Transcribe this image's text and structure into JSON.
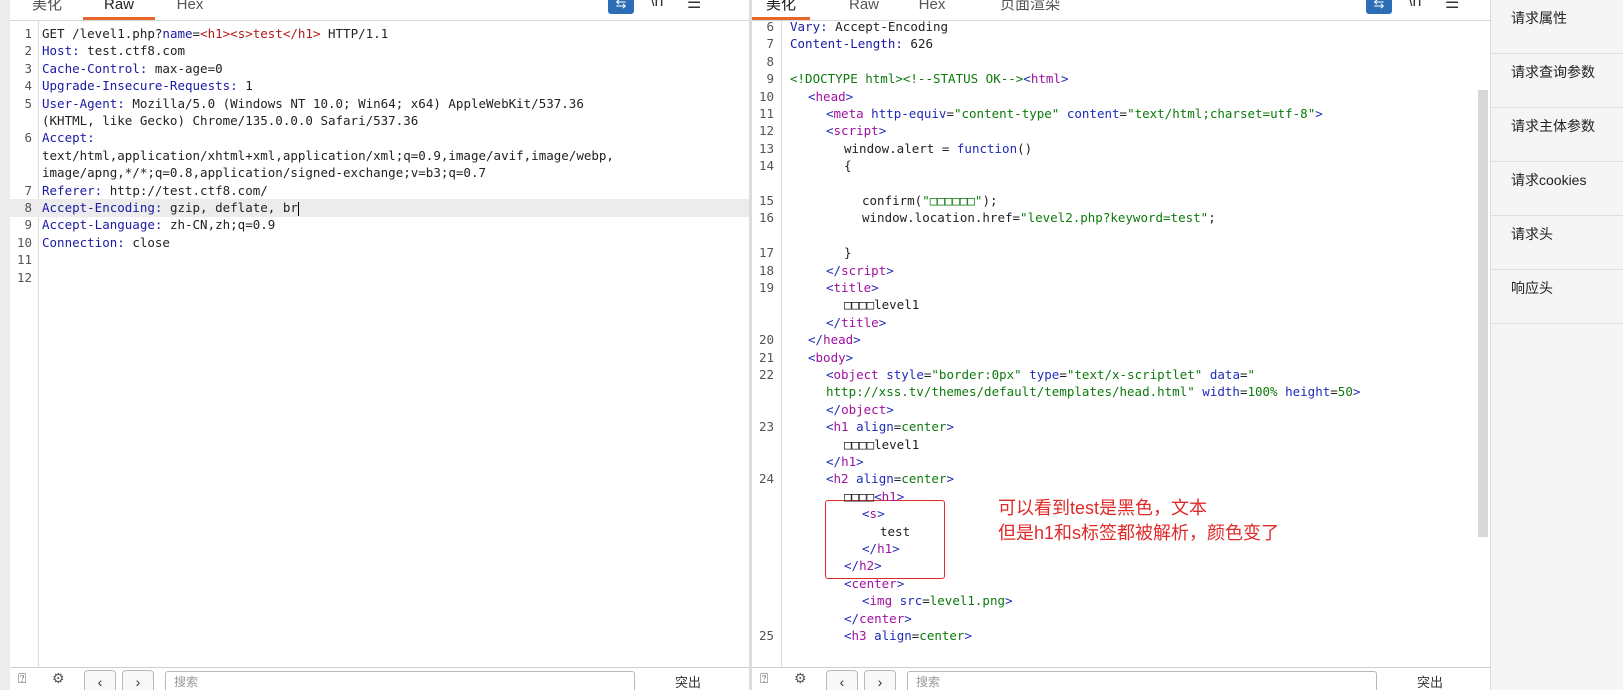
{
  "request_pane": {
    "tabs": [
      {
        "label": "美化",
        "active": false
      },
      {
        "label": "Raw",
        "active": true
      },
      {
        "label": "Hex",
        "active": false
      }
    ],
    "toolbar_icons": [
      "wrap-icon",
      "newline-icon",
      "menu-icon"
    ],
    "lines": [
      {
        "num": "1",
        "parts": [
          [
            "plain",
            "GET /level1.php?"
          ],
          [
            "key",
            "name"
          ],
          [
            "plain",
            "="
          ],
          [
            "red",
            "<h1><s>test</h1>"
          ],
          [
            "plain",
            " HTTP/1.1"
          ]
        ]
      },
      {
        "num": "2",
        "parts": [
          [
            "key",
            "Host:"
          ],
          [
            "plain",
            " test.ctf8.com"
          ]
        ]
      },
      {
        "num": "3",
        "parts": [
          [
            "key",
            "Cache-Control:"
          ],
          [
            "plain",
            " max-age=0"
          ]
        ]
      },
      {
        "num": "4",
        "parts": [
          [
            "key",
            "Upgrade-Insecure-Requests:"
          ],
          [
            "plain",
            " 1"
          ]
        ]
      },
      {
        "num": "5",
        "parts": [
          [
            "key",
            "User-Agent:"
          ],
          [
            "plain",
            " Mozilla/5.0 (Windows NT 10.0; Win64; x64) AppleWebKit/537.36"
          ]
        ]
      },
      {
        "num": "",
        "parts": [
          [
            "plain",
            "(KHTML, like Gecko) Chrome/135.0.0.0 Safari/537.36"
          ]
        ]
      },
      {
        "num": "6",
        "parts": [
          [
            "key",
            "Accept:"
          ]
        ]
      },
      {
        "num": "",
        "parts": [
          [
            "plain",
            "text/html,application/xhtml+xml,application/xml;q=0.9,image/avif,image/webp,"
          ]
        ]
      },
      {
        "num": "",
        "parts": [
          [
            "plain",
            "image/apng,*/*;q=0.8,application/signed-exchange;v=b3;q=0.7"
          ]
        ]
      },
      {
        "num": "7",
        "parts": [
          [
            "key",
            "Referer:"
          ],
          [
            "plain",
            " http://test.ctf8.com/"
          ]
        ]
      },
      {
        "num": "8",
        "parts": [
          [
            "key",
            "Accept-Encoding:"
          ],
          [
            "plain",
            " gzip, deflate, br"
          ]
        ],
        "highlight": true,
        "cursor": true
      },
      {
        "num": "9",
        "parts": [
          [
            "key",
            "Accept-Language:"
          ],
          [
            "plain",
            " zh-CN,zh;q=0.9"
          ]
        ]
      },
      {
        "num": "10",
        "parts": [
          [
            "key",
            "Connection:"
          ],
          [
            "plain",
            " close"
          ]
        ]
      },
      {
        "num": "11",
        "parts": []
      },
      {
        "num": "12",
        "parts": []
      }
    ],
    "search_placeholder": "搜索"
  },
  "response_pane": {
    "tabs": [
      {
        "label": "美化",
        "active": true
      },
      {
        "label": "Raw",
        "active": false
      },
      {
        "label": "Hex",
        "active": false
      },
      {
        "label": "页面渲染",
        "active": false
      }
    ],
    "toolbar_icons": [
      "wrap-icon",
      "newline-icon",
      "menu-icon"
    ],
    "lines": [
      {
        "num": "6",
        "parts": [
          [
            "key",
            "Vary:"
          ],
          [
            "plain",
            " Accept-Encoding"
          ]
        ]
      },
      {
        "num": "7",
        "parts": [
          [
            "key",
            "Content-Length:"
          ],
          [
            "plain",
            " 626"
          ]
        ]
      },
      {
        "num": "8",
        "parts": []
      },
      {
        "num": "9",
        "parts": [
          [
            "com",
            "<!DOCTYPE html><!--STATUS OK-->"
          ],
          [
            "br",
            "<"
          ],
          [
            "tag",
            "html"
          ],
          [
            "br",
            ">"
          ]
        ]
      },
      {
        "num": "10",
        "indent": 1,
        "parts": [
          [
            "br",
            "<"
          ],
          [
            "tag",
            "head"
          ],
          [
            "br",
            ">"
          ]
        ]
      },
      {
        "num": "11",
        "indent": 2,
        "parts": [
          [
            "br",
            "<"
          ],
          [
            "tag",
            "meta"
          ],
          [
            "plain",
            " "
          ],
          [
            "attr",
            "http-equiv"
          ],
          [
            "plain",
            "="
          ],
          [
            "str",
            "\"content-type\""
          ],
          [
            "plain",
            " "
          ],
          [
            "attr",
            "content"
          ],
          [
            "plain",
            "="
          ],
          [
            "str",
            "\"text/html;charset=utf-8\""
          ],
          [
            "br",
            ">"
          ]
        ]
      },
      {
        "num": "12",
        "indent": 2,
        "parts": [
          [
            "br",
            "<"
          ],
          [
            "tag",
            "script"
          ],
          [
            "br",
            ">"
          ]
        ]
      },
      {
        "num": "13",
        "indent": 3,
        "parts": [
          [
            "plain",
            "window.alert = "
          ],
          [
            "attr",
            "function"
          ],
          [
            "plain",
            "()"
          ]
        ]
      },
      {
        "num": "14",
        "indent": 3,
        "parts": [
          [
            "plain",
            "{"
          ]
        ]
      },
      {
        "num": "",
        "parts": []
      },
      {
        "num": "15",
        "indent": 4,
        "parts": [
          [
            "plain",
            "confirm("
          ],
          [
            "str",
            "\"□□□□□□\""
          ],
          [
            "plain",
            ");"
          ]
        ]
      },
      {
        "num": "16",
        "indent": 4,
        "parts": [
          [
            "plain",
            "window.location.href="
          ],
          [
            "str",
            "\"level2.php?keyword=test\""
          ],
          [
            "plain",
            ";"
          ]
        ]
      },
      {
        "num": "",
        "parts": []
      },
      {
        "num": "17",
        "indent": 3,
        "parts": [
          [
            "plain",
            "}"
          ]
        ]
      },
      {
        "num": "18",
        "indent": 2,
        "parts": [
          [
            "br",
            "</"
          ],
          [
            "tag",
            "script"
          ],
          [
            "br",
            ">"
          ]
        ]
      },
      {
        "num": "19",
        "indent": 2,
        "parts": [
          [
            "br",
            "<"
          ],
          [
            "tag",
            "title"
          ],
          [
            "br",
            ">"
          ]
        ]
      },
      {
        "num": "",
        "indent": 3,
        "parts": [
          [
            "plain",
            "□□□□level1"
          ]
        ]
      },
      {
        "num": "",
        "indent": 2,
        "parts": [
          [
            "br",
            "</"
          ],
          [
            "tag",
            "title"
          ],
          [
            "br",
            ">"
          ]
        ]
      },
      {
        "num": "20",
        "indent": 1,
        "parts": [
          [
            "br",
            "</"
          ],
          [
            "tag",
            "head"
          ],
          [
            "br",
            ">"
          ]
        ]
      },
      {
        "num": "21",
        "indent": 1,
        "parts": [
          [
            "br",
            "<"
          ],
          [
            "tag",
            "body"
          ],
          [
            "br",
            ">"
          ]
        ]
      },
      {
        "num": "22",
        "indent": 2,
        "parts": [
          [
            "br",
            "<"
          ],
          [
            "tag",
            "object"
          ],
          [
            "plain",
            " "
          ],
          [
            "attr",
            "style"
          ],
          [
            "plain",
            "="
          ],
          [
            "str",
            "\"border:0px\""
          ],
          [
            "plain",
            " "
          ],
          [
            "attr",
            "type"
          ],
          [
            "plain",
            "="
          ],
          [
            "str",
            "\"text/x-scriptlet\""
          ],
          [
            "plain",
            " "
          ],
          [
            "attr",
            "data"
          ],
          [
            "plain",
            "="
          ],
          [
            "str",
            "\""
          ]
        ]
      },
      {
        "num": "",
        "indent": 2,
        "parts": [
          [
            "str",
            "http://xss.tv/themes/default/templates/head.html\""
          ],
          [
            "plain",
            " "
          ],
          [
            "attr",
            "width"
          ],
          [
            "plain",
            "="
          ],
          [
            "str",
            "100%"
          ],
          [
            "plain",
            " "
          ],
          [
            "attr",
            "height"
          ],
          [
            "plain",
            "="
          ],
          [
            "str",
            "50"
          ],
          [
            "br",
            ">"
          ]
        ]
      },
      {
        "num": "",
        "indent": 2,
        "parts": [
          [
            "br",
            "</"
          ],
          [
            "tag",
            "object"
          ],
          [
            "br",
            ">"
          ]
        ]
      },
      {
        "num": "23",
        "indent": 2,
        "parts": [
          [
            "br",
            "<"
          ],
          [
            "tag",
            "h1"
          ],
          [
            "plain",
            " "
          ],
          [
            "attr",
            "align"
          ],
          [
            "plain",
            "="
          ],
          [
            "str",
            "center"
          ],
          [
            "br",
            ">"
          ]
        ]
      },
      {
        "num": "",
        "indent": 3,
        "parts": [
          [
            "plain",
            "□□□□level1"
          ]
        ]
      },
      {
        "num": "",
        "indent": 2,
        "parts": [
          [
            "br",
            "</"
          ],
          [
            "tag",
            "h1"
          ],
          [
            "br",
            ">"
          ]
        ]
      },
      {
        "num": "24",
        "indent": 2,
        "parts": [
          [
            "br",
            "<"
          ],
          [
            "tag",
            "h2"
          ],
          [
            "plain",
            " "
          ],
          [
            "attr",
            "align"
          ],
          [
            "plain",
            "="
          ],
          [
            "str",
            "center"
          ],
          [
            "br",
            ">"
          ]
        ]
      },
      {
        "num": "",
        "indent": 3,
        "parts": [
          [
            "plain",
            "□□□□"
          ],
          [
            "br",
            "<"
          ],
          [
            "tag",
            "h1"
          ],
          [
            "br",
            ">"
          ]
        ]
      },
      {
        "num": "",
        "indent": 4,
        "parts": [
          [
            "br",
            "<"
          ],
          [
            "tag",
            "s"
          ],
          [
            "br",
            ">"
          ]
        ]
      },
      {
        "num": "",
        "indent": 5,
        "parts": [
          [
            "plain",
            "test"
          ]
        ]
      },
      {
        "num": "",
        "indent": 4,
        "parts": [
          [
            "br",
            "</"
          ],
          [
            "tag",
            "h1"
          ],
          [
            "br",
            ">"
          ]
        ]
      },
      {
        "num": "",
        "indent": 3,
        "parts": [
          [
            "br",
            "</"
          ],
          [
            "tag",
            "h2"
          ],
          [
            "br",
            ">"
          ]
        ]
      },
      {
        "num": "",
        "indent": 3,
        "parts": [
          [
            "br",
            "<"
          ],
          [
            "tag",
            "center"
          ],
          [
            "br",
            ">"
          ]
        ]
      },
      {
        "num": "",
        "indent": 4,
        "parts": [
          [
            "br",
            "<"
          ],
          [
            "tag",
            "img"
          ],
          [
            "plain",
            " "
          ],
          [
            "attr",
            "src"
          ],
          [
            "plain",
            "="
          ],
          [
            "str",
            "level1.png"
          ],
          [
            "br",
            ">"
          ]
        ]
      },
      {
        "num": "",
        "indent": 3,
        "parts": [
          [
            "br",
            "</"
          ],
          [
            "tag",
            "center"
          ],
          [
            "br",
            ">"
          ]
        ]
      },
      {
        "num": "25",
        "indent": 3,
        "parts": [
          [
            "br",
            "<"
          ],
          [
            "tag",
            "h3"
          ],
          [
            "plain",
            " "
          ],
          [
            "attr",
            "align"
          ],
          [
            "plain",
            "="
          ],
          [
            "str",
            "center"
          ],
          [
            "br",
            ">"
          ]
        ]
      }
    ],
    "annotation": {
      "line1": "可以看到test是黑色，文本",
      "line2": "但是h1和s标签都被解析，颜色变了",
      "color": "#e02a2a"
    },
    "search_placeholder": "搜索"
  },
  "side_panel": {
    "items": [
      "请求属性",
      "请求查询参数",
      "请求主体参数",
      "请求cookies",
      "请求头",
      "响应头"
    ]
  },
  "bottom_bar": {
    "match_text": "突出"
  },
  "colors": {
    "accent_tab": "#e8652c",
    "toolbar_button": "#2d6db5",
    "annotation": "#e02a2a"
  }
}
